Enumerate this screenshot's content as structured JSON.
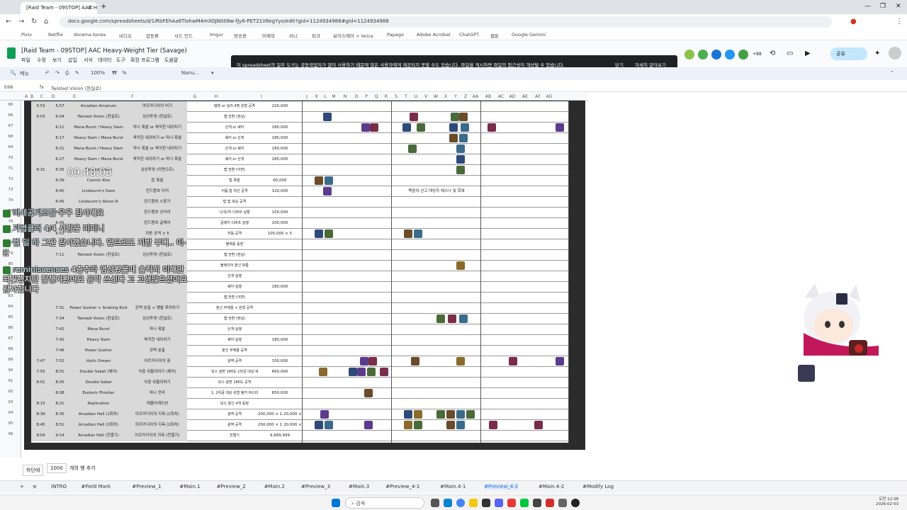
{
  "browser": {
    "tab_title": "[Raid Team - 09STOP] AAC He",
    "url": "docs.google.com/spreadsheets/d/1iRbFEhAa6TlohwM4mXOJN008w-fJy6-PET21V8egYyo/edit?gid=1124934988#gid=1124934988",
    "bookmarks": [
      "Pixiv",
      "Netflix",
      "dorama korea",
      "비디오",
      "잡동류",
      "사드 인드",
      "Imgur",
      "방송용",
      "이예작",
      "러니",
      "피크",
      "보이스에이 > Voice",
      "Papago",
      "Adobe Acrobat",
      "ChatGPT",
      "웹툰",
      "Google Gemini"
    ]
  },
  "doc": {
    "title": "[Raid Team - 09STOP] AAC Heavy-Weight Tier (Savage)",
    "menus": [
      "파일",
      "수정",
      "보기",
      "삽입",
      "서식",
      "데이터",
      "도구",
      "확장 프로그램",
      "도움말"
    ],
    "share_label": "공유",
    "collaborator_count": "+88"
  },
  "toast": {
    "message": "이 spreadsheet의 일부 도구는 공동작업자가 많이 사용하기 때문에 많은 사용자에게 제공되지 못할 수도 있습니다. 파일을 게시하면 파일의 접근성이 개선될 수 있습니다.",
    "close_label": "닫기",
    "learn_label": "자세히 알아보기"
  },
  "toolbar": {
    "zoom": "100%",
    "font": "Nanu...",
    "menu_label": "메뉴"
  },
  "formula": {
    "cell_ref": "E66",
    "value": "Twisted Vision (현실로)"
  },
  "columns": [
    "A",
    "B",
    "C",
    "D",
    "E",
    "F",
    "G",
    "H",
    "I",
    "J",
    "K",
    "L",
    "M",
    "N",
    "O",
    "P",
    "Q",
    "R",
    "S",
    "T",
    "U",
    "V",
    "W",
    "X",
    "Y",
    "Z",
    "AA",
    "AB",
    "AC",
    "AD",
    "AE",
    "AF",
    "AG"
  ],
  "rows": [
    {
      "n": "66",
      "t1": "5:53",
      "t2": "5:57",
      "name": "Arcadian Arcanum",
      "kor": "아르카디아의 비기",
      "note": "탱힐 or 딜러 4명 원형 공격",
      "dmg": "220,000",
      "icon": false
    },
    {
      "n": "66",
      "t1": "6:03",
      "t2": "6:04",
      "name": "Twisted Vision (현실로)",
      "kor": "심상투영 (현실로)",
      "note": "맵 전환 (현실)",
      "dmg": "",
      "icon": true
    },
    {
      "n": "67",
      "t1": "",
      "t2": "6:11",
      "name": "Mana Burst / Heavy Slam",
      "kor": "마나 폭발 or 육직한 내려치기",
      "note": "산개 or 쉐어",
      "dmg": "180,000",
      "icon": true
    },
    {
      "n": "68",
      "t1": "",
      "t2": "6:17",
      "name": "Heavy Slam / Mana Burst",
      "kor": "육직한 내려치기 or 마나 폭발",
      "note": "쉐어 or 산개",
      "dmg": "180,000",
      "icon": true
    },
    {
      "n": "69",
      "t1": "",
      "t2": "6:21",
      "name": "Mana Burst / Heavy Slam",
      "kor": "마나 폭발 or 육직한 내려치기",
      "note": "산개 or 쉐어",
      "dmg": "180,000",
      "icon": true
    },
    {
      "n": "70",
      "t1": "",
      "t2": "6:27",
      "name": "Heavy Slam / Mana Burst",
      "kor": "육직한 내려치기 or 마나 폭발",
      "note": "쉐어 or 산개",
      "dmg": "180,000",
      "icon": true
    },
    {
      "n": "71",
      "t1": "6:31",
      "t2": "6:35",
      "name": "Twisted Vision",
      "kor": "심상투영 (이면으로)",
      "note": "맵 전환 (이면)",
      "dmg": "",
      "icon": false
    },
    {
      "n": "72",
      "t1": "",
      "t2": "6:39",
      "name": "Cosmic Kiss",
      "kor": "탑 폭발",
      "note": "탑 폭발",
      "dmg": "60,000",
      "icon": true
    },
    {
      "n": "73",
      "t1": "",
      "t2": "6:40",
      "name": "Lindwurm's Dare",
      "kor": "린드붐흐 다리",
      "note": "어둠 탑 직선 공격",
      "dmg": "120,000",
      "icon": true
    },
    {
      "n": "74",
      "t1": "",
      "t2": "6:45",
      "name": "Lindwurm's Stone III",
      "kor": "린드붐흐 스톤가",
      "note": "탑 탑 측승 공격",
      "dmg": "",
      "icon": false
    },
    {
      "n": "75",
      "t1": "",
      "t2": "6:45",
      "name": "",
      "kor": "린드붐흐 선더라",
      "note": "나/유/자 디버프 실행",
      "dmg": "100,000",
      "icon": true
    },
    {
      "n": "76",
      "t1": "",
      "t2": "6:45",
      "name": "",
      "kor": "린드붐흐 글레어",
      "note": "글레어 디버프 실행",
      "dmg": "100,000",
      "icon": false
    },
    {
      "n": "77",
      "t1": "",
      "t2": "6:51",
      "name": "",
      "kor": "자동 공격 × 5",
      "note": "자동 공격",
      "dmg": "105,000 × 5",
      "icon": true
    },
    {
      "n": "78",
      "t1": "",
      "t2": "",
      "name": "",
      "kor": "",
      "note": "블랙홀 등장",
      "dmg": "",
      "icon": false
    },
    {
      "n": "79",
      "t1": "",
      "t2": "7:11",
      "name": "Twisted Vision (현실로)",
      "kor": "심상투영 (현실로)",
      "note": "맵 전환 (현실)",
      "dmg": "",
      "icon": false
    },
    {
      "n": "80",
      "t1": "",
      "t2": "",
      "name": "",
      "kor": "",
      "note": "블레이어 분신 파통",
      "dmg": "",
      "icon": false
    },
    {
      "n": "81",
      "t1": "",
      "t2": "",
      "name": "",
      "kor": "",
      "note": "산개 실행",
      "dmg": "",
      "icon": false
    },
    {
      "n": "82",
      "t1": "",
      "t2": "",
      "name": "",
      "kor": "",
      "note": "쉐어 실행",
      "dmg": "180,000",
      "icon": true
    },
    {
      "n": "83",
      "t1": "",
      "t2": "",
      "name": "",
      "kor": "",
      "note": "맵 전환 (이면)",
      "dmg": "",
      "icon": false
    },
    {
      "n": "84",
      "t1": "",
      "t2": "7:31",
      "name": "Power Gusher + Snaking Kick",
      "kor": "강력 분출 + 뱀발 후려차기",
      "note": "분신 부채꼴 + 원형 공격",
      "dmg": "",
      "icon": false
    },
    {
      "n": "85",
      "t1": "",
      "t2": "7:34",
      "name": "Twisted Vision (현실로)",
      "kor": "심상투영 (현실로)",
      "note": "맵 전환 (현실)",
      "dmg": "",
      "icon": false
    },
    {
      "n": "86",
      "t1": "",
      "t2": "7:42",
      "name": "Mana Burst",
      "kor": "마나 폭발",
      "note": "산개 실행",
      "dmg": "",
      "icon": false
    },
    {
      "n": "87",
      "t1": "",
      "t2": "7:42",
      "name": "Heavy Slam",
      "kor": "육직한 내려치기",
      "note": "쉐어 실행",
      "dmg": "180,000",
      "icon": true
    },
    {
      "n": "88",
      "t1": "",
      "t2": "7:46",
      "name": "Power Gusher",
      "kor": "강력 분출",
      "note": "분신 부채꼴 공격",
      "dmg": "",
      "icon": false
    },
    {
      "n": "89",
      "t1": "7:47",
      "t2": "7:52",
      "name": "Idylic Dream",
      "kor": "아르카디아의 꿈",
      "note": "광역 공격",
      "dmg": "330,000",
      "icon": true
    },
    {
      "n": "90",
      "t1": "7:55",
      "t2": "8:01",
      "name": "Double Sabat (쉐어)",
      "kor": "이중 뒤돌려차기 (쉐어)",
      "note": "보스 광면 180도 1머금 대상 쉐어 공격",
      "dmg": "660,000",
      "icon": true
    },
    {
      "n": "91",
      "t1": "8:01",
      "t2": "8:05",
      "name": "Double Sabat",
      "kor": "이중 뒤돌려차기",
      "note": "보스 광면 180도 공격",
      "dmg": "",
      "icon": false
    },
    {
      "n": "92",
      "t1": "",
      "t2": "8:08",
      "name": "Esoteric Finisher",
      "kor": "마나 연곡",
      "note": "1, 2위글 대상 원형 탱커 버스터",
      "dmg": "650,000",
      "icon": false
    },
    {
      "n": "93",
      "t1": "8:15",
      "t2": "8:21",
      "name": "Replication",
      "kor": "레플리케이션",
      "note": "보스 분신 4개 등장",
      "dmg": "",
      "icon": false
    },
    {
      "n": "94",
      "t1": "8:39",
      "t2": "8:35",
      "name": "Arcadian Hell (1회차)",
      "kor": "아르카디아의 지옥 (1회차)",
      "note": "광역 공격",
      "dmg": "200,000 × 1 20,000 × 4",
      "icon": true
    },
    {
      "n": "95",
      "t1": "8:45",
      "t2": "8:51",
      "name": "Arcadian Hell (2회차)",
      "kor": "아르카디아의 지옥 (2회차)",
      "note": "광역 공격",
      "dmg": "200,000 × 1 20,000 × 8",
      "icon": true
    },
    {
      "n": "96",
      "t1": "9:04",
      "t2": "9:14",
      "name": "Arcadian Hell (전멸기)",
      "kor": "아르카디아의 지옥 (전멸기)",
      "note": "전멸기",
      "dmg": "9,999,999",
      "icon": false
    }
  ],
  "merged_notes": {
    "row72": "죽음의 선고 대상자 에스나 및 회복"
  },
  "overlay": {
    "timer": "09:48:03",
    "chat": [
      {
        "name": "미세공기조절",
        "text": "우우 감사해요"
      },
      {
        "name": "가볍클러",
        "text": "4/4 사랑은 미미니"
      },
      {
        "name": "텔 일 하",
        "text": "그간 감사했습니다. 앞으로도 지방 부디.. 이-(("
      },
      {
        "name": "reminiscences",
        "text": "4층추라 영상봤을때 솔직히 이해안되긴했지만 잘챙겨봤어요 공략 쓰신다 고 고생많으셨어요 감사합니다"
      }
    ]
  },
  "bottom": {
    "add_label": "하단에",
    "row_count": "1000",
    "rows_suffix": "개의 행 추가"
  },
  "sheet_tabs": [
    "INTRO",
    "#Field Mark",
    "#Preview_1",
    "#Main.1",
    "#Preview_2",
    "#Main.2",
    "#Preview_3",
    "#Main.3",
    "#Preview_4-1",
    "#Main.4-1",
    "#Preview_4-2",
    "#Main.4-2",
    "#Modify Log"
  ],
  "active_tab": "#Preview_4-2",
  "taskbar": {
    "search_placeholder": "검색",
    "time": "오전 12:38",
    "date": "2026-02-03"
  },
  "colors": {
    "sheets_green": "#0f9d58",
    "accent_blue": "#1a73e8",
    "dark_bg": "#2b2b2b",
    "gray_cell": "#d9d9d9",
    "toast_bg": "#202124"
  }
}
